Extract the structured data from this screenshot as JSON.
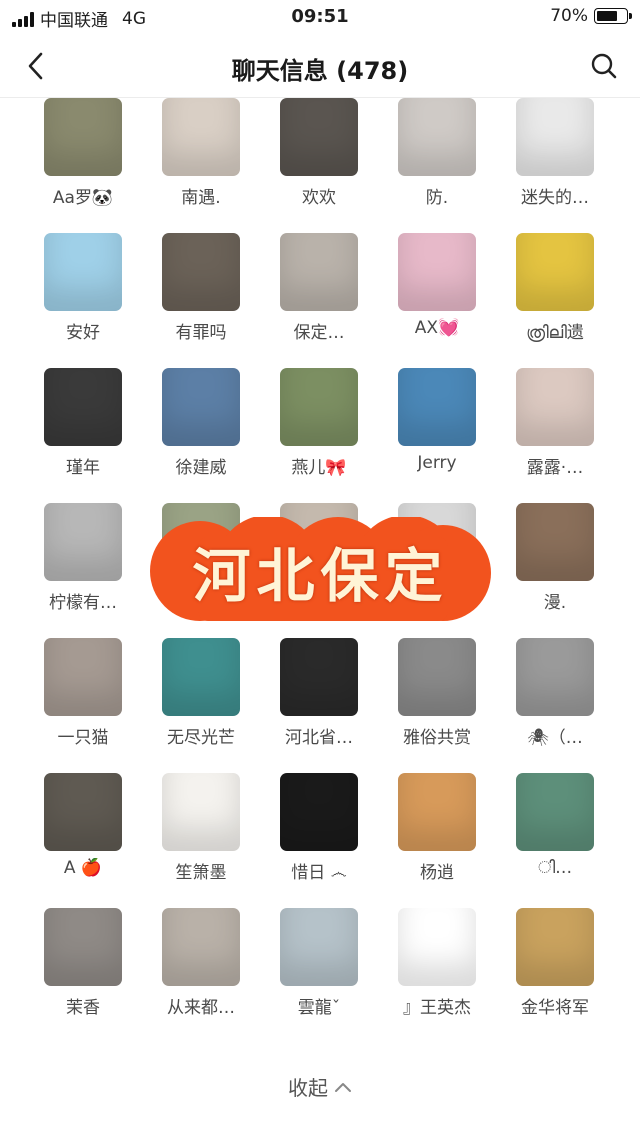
{
  "status_bar": {
    "carrier": "中国联通",
    "network": "4G",
    "time": "09:51",
    "battery": "70%",
    "battery_level": 0.7
  },
  "nav": {
    "title": "聊天信息 (478)",
    "back_icon": "chevron-left-icon",
    "search_icon": "search-icon"
  },
  "members": [
    {
      "name": "Aa罗🐼",
      "bg": "#8a8a6e"
    },
    {
      "name": "南遇.",
      "bg": "#d9cfc5"
    },
    {
      "name": "欢欢",
      "bg": "#5a5550"
    },
    {
      "name": "防.",
      "bg": "#cfcac6"
    },
    {
      "name": "迷失的…",
      "bg": "#e9e9e9"
    },
    {
      "name": "安好",
      "bg": "#9fd0e8"
    },
    {
      "name": "有罪吗",
      "bg": "#6b6258"
    },
    {
      "name": "保定…",
      "bg": "#b9b2aa"
    },
    {
      "name": "AX💓",
      "bg": "#e7b9c9"
    },
    {
      "name": "ത്രിലി遗",
      "bg": "#e4c441"
    },
    {
      "name": "瑾年",
      "bg": "#3a3a3a"
    },
    {
      "name": "徐建威",
      "bg": "#5c7fa6"
    },
    {
      "name": "燕儿🎀",
      "bg": "#7c8f62"
    },
    {
      "name": "Jerry",
      "bg": "#4b88b8"
    },
    {
      "name": "露露·…",
      "bg": "#dcc9c1"
    },
    {
      "name": "柠檬有…",
      "bg": "#b7b7b7"
    },
    {
      "name": "",
      "bg": "#9aa385"
    },
    {
      "name": "",
      "bg": "#c4b9ad"
    },
    {
      "name": "",
      "bg": "#d8d8d8"
    },
    {
      "name": "漫.",
      "bg": "#8a6f5a"
    },
    {
      "name": "一只猫",
      "bg": "#a59a92"
    },
    {
      "name": "无尽光芒",
      "bg": "#3f8f8f"
    },
    {
      "name": "河北省…",
      "bg": "#2a2a2a"
    },
    {
      "name": "雅俗共赏",
      "bg": "#8a8a8a"
    },
    {
      "name": "🕷（…",
      "bg": "#9a9a9a"
    },
    {
      "name": "A 🍎",
      "bg": "#5f5a52"
    },
    {
      "name": "笙箫墨",
      "bg": "#f4f2ee"
    },
    {
      "name": "惜日 ෴",
      "bg": "#1a1a1a"
    },
    {
      "name": "杨逍",
      "bg": "#d79a5a"
    },
    {
      "name": "ി…",
      "bg": "#5d8f7a"
    },
    {
      "name": "茉香",
      "bg": "#8f8a86"
    },
    {
      "name": "从来都…",
      "bg": "#b9b1a8"
    },
    {
      "name": "雲龍ˇ",
      "bg": "#b5c2c9"
    },
    {
      "name": "』王英杰",
      "bg": "#ffffff"
    },
    {
      "name": "金华将军",
      "bg": "#c9a25e"
    }
  ],
  "overlay": {
    "text": "河北保定",
    "color": "#f2531e"
  },
  "footer": {
    "collapse_label": "收起",
    "collapse_icon": "chevron-up-icon"
  }
}
